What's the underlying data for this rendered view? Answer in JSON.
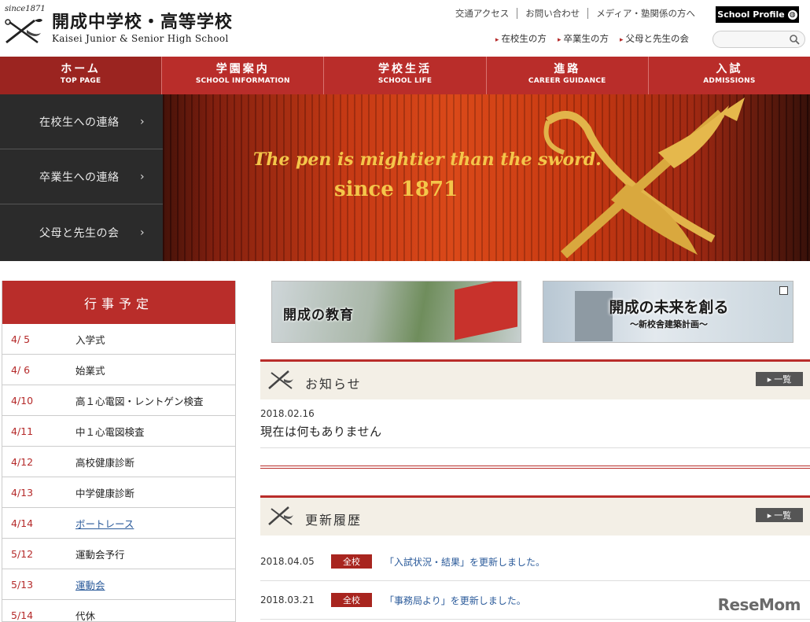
{
  "header": {
    "since": "since1871",
    "school_name_jp": "開成中学校・高等学校",
    "school_name_en": "Kaisei Junior & Senior High School",
    "util_links": [
      "交通アクセス",
      "お問い合わせ",
      "メディア・塾関係の方へ"
    ],
    "profile_button": "School Profile",
    "sub_links": [
      "在校生の方",
      "卒業生の方",
      "父母と先生の会"
    ],
    "search_placeholder": ""
  },
  "nav": [
    {
      "jp": "ホーム",
      "en": "TOP PAGE"
    },
    {
      "jp": "学園案内",
      "en": "SCHOOL INFORMATION"
    },
    {
      "jp": "学校生活",
      "en": "SCHOOL LIFE"
    },
    {
      "jp": "進路",
      "en": "CAREER GUIDANCE"
    },
    {
      "jp": "入試",
      "en": "ADMISSIONS"
    }
  ],
  "side_menu": [
    "在校生への連絡",
    "卒業生への連絡",
    "父母と先生の会"
  ],
  "hero": {
    "motto": "The pen is mightier than the sword.",
    "year": "since 1871"
  },
  "events": {
    "title": "行事予定",
    "items": [
      {
        "date": "4/ 5",
        "name": "入学式"
      },
      {
        "date": "4/ 6",
        "name": "始業式"
      },
      {
        "date": "4/10",
        "name": "高１心電図・レントゲン検査"
      },
      {
        "date": "4/11",
        "name": "中１心電図検査"
      },
      {
        "date": "4/12",
        "name": "高校健康診断"
      },
      {
        "date": "4/13",
        "name": "中学健康診断"
      },
      {
        "date": "4/14",
        "name": "ボートレース"
      },
      {
        "date": "5/12",
        "name": "運動会予行"
      },
      {
        "date": "5/13",
        "name": "運動会"
      },
      {
        "date": "5/14",
        "name": "代休"
      }
    ]
  },
  "banners": {
    "left": "開成の教育",
    "right_title": "開成の未来を創る",
    "right_sub": "〜新校舎建築計画〜"
  },
  "news": {
    "title": "お知らせ",
    "more": "一覧",
    "date": "2018.02.16",
    "text": "現在は何もありません"
  },
  "updates": {
    "title": "更新履歴",
    "more": "一覧",
    "items": [
      {
        "date": "2018.04.05",
        "tag": "全校",
        "text": "「入試状況・結果」を更新しました。"
      },
      {
        "date": "2018.03.21",
        "tag": "全校",
        "text": "「事務局より」を更新しました。"
      }
    ]
  },
  "watermark": "ReseMom",
  "colors": {
    "accent": "#b92d2a",
    "nav_active": "#9b2420",
    "link": "#2a5a9a"
  }
}
